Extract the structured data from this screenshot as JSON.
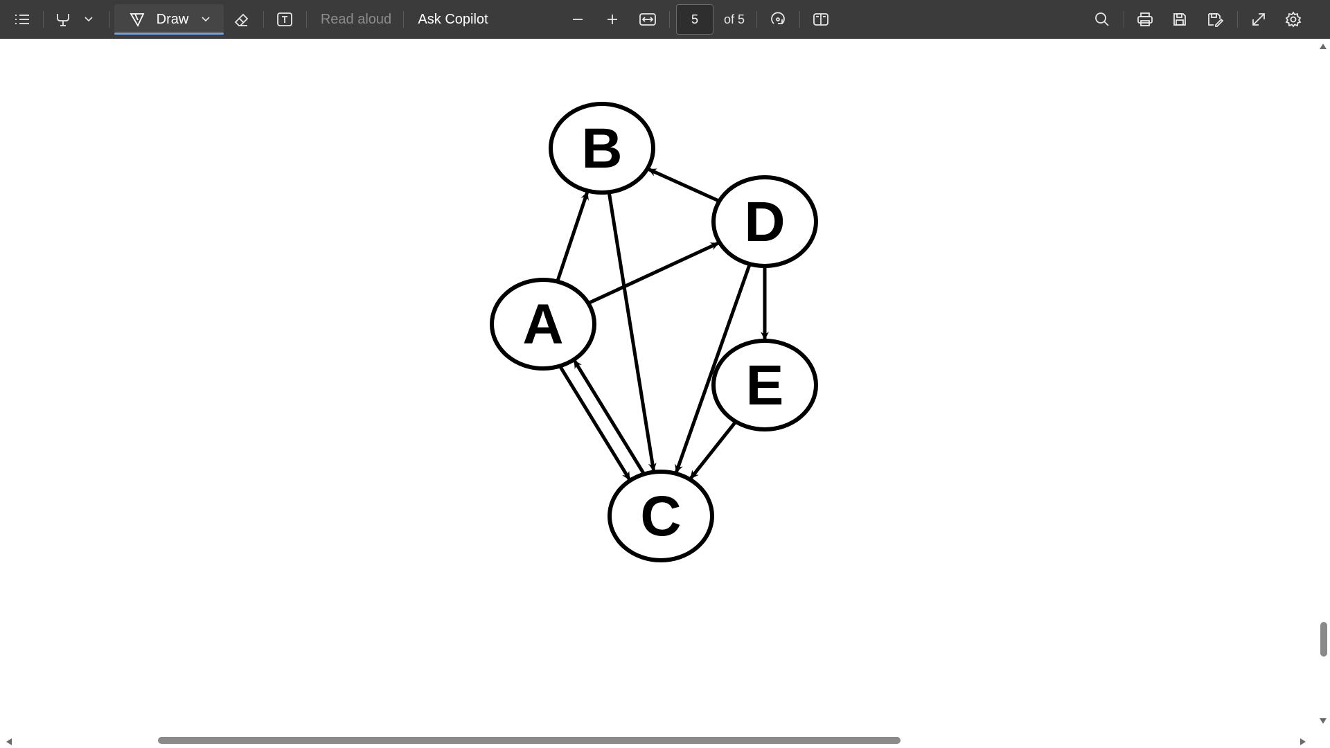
{
  "toolbar": {
    "draw_label": "Draw",
    "read_aloud_label": "Read aloud",
    "ask_copilot_label": "Ask Copilot",
    "page_current": "5",
    "page_total": "of 5"
  },
  "icons": [
    "contents-icon",
    "highlight-icon",
    "chevron-down-icon",
    "draw-icon",
    "eraser-icon",
    "text-box-icon",
    "zoom-out-icon",
    "zoom-in-icon",
    "fit-width-icon",
    "rotate-icon",
    "page-view-icon",
    "search-icon",
    "print-icon",
    "save-icon",
    "save-as-icon",
    "fullscreen-icon",
    "settings-icon"
  ],
  "colors": {
    "toolbar_bg": "#3b3b3b",
    "accent": "#60a5fa",
    "page_bg": "#ffffff"
  },
  "diagram": {
    "nodes": [
      {
        "id": "A",
        "label": "A"
      },
      {
        "id": "B",
        "label": "B"
      },
      {
        "id": "C",
        "label": "C"
      },
      {
        "id": "D",
        "label": "D"
      },
      {
        "id": "E",
        "label": "E"
      }
    ],
    "edges": [
      {
        "from": "A",
        "to": "B"
      },
      {
        "from": "A",
        "to": "D"
      },
      {
        "from": "A",
        "to": "C"
      },
      {
        "from": "C",
        "to": "A"
      },
      {
        "from": "B",
        "to": "C"
      },
      {
        "from": "D",
        "to": "B"
      },
      {
        "from": "D",
        "to": "C"
      },
      {
        "from": "D",
        "to": "E"
      },
      {
        "from": "E",
        "to": "C"
      }
    ]
  }
}
